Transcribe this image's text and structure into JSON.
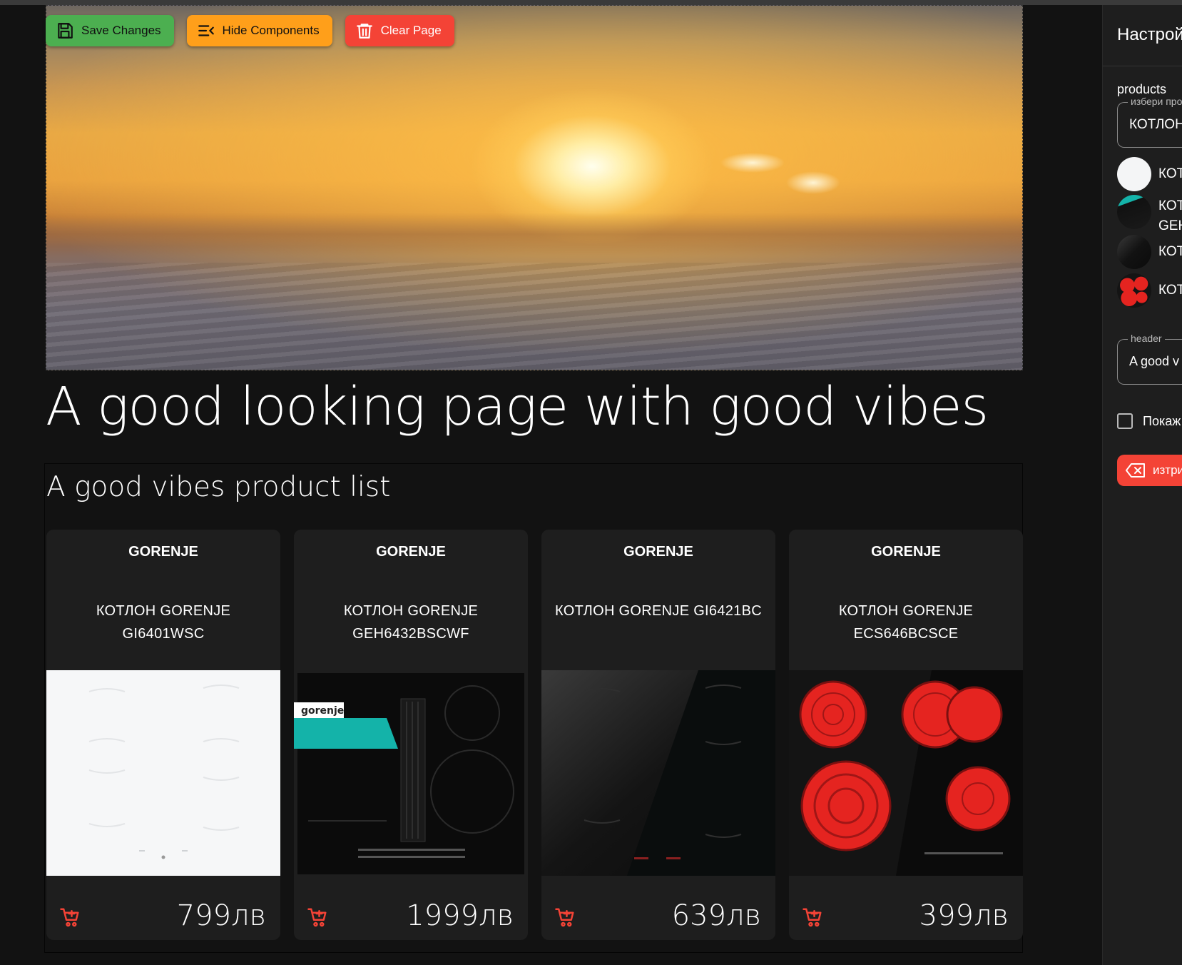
{
  "toolbar": {
    "save_label": "Save Changes",
    "hide_label": "Hide Components",
    "clear_label": "Clear Page"
  },
  "page": {
    "title": "A good looking page with good vibes"
  },
  "product_list": {
    "title": "A good vibes product list",
    "items": [
      {
        "brand": "GORENJE",
        "name": "КОТЛОН GORENJE GI6401WSC",
        "price": "799лв"
      },
      {
        "brand": "GORENJE",
        "name": "КОТЛОН GORENJE GEH6432BSCWF",
        "price": "1999лв"
      },
      {
        "brand": "GORENJE",
        "name": "КОТЛОН GORENJE GI6421BC",
        "price": "639лв"
      },
      {
        "brand": "GORENJE",
        "name": "КОТЛОН GORENJE ECS646BCSCE",
        "price": "399лв"
      }
    ]
  },
  "panel": {
    "title": "Настрой",
    "products_label": "products",
    "products_legend": "избери про",
    "products_value": "КОТЛОН",
    "options": [
      {
        "text": "КОТ"
      },
      {
        "text": "КОТ",
        "text2": "GEH"
      },
      {
        "text": "КОТ"
      },
      {
        "text": "КОТ"
      }
    ],
    "header_legend": "header",
    "header_value": "A good v",
    "checkbox_label": "Покаж",
    "delete_label": "изтри"
  },
  "colors": {
    "save": "#4caf50",
    "hide": "#ff9f1a",
    "clear": "#f44336",
    "cart": "#f44336",
    "background": "#121212",
    "card": "#1e1e1e"
  }
}
